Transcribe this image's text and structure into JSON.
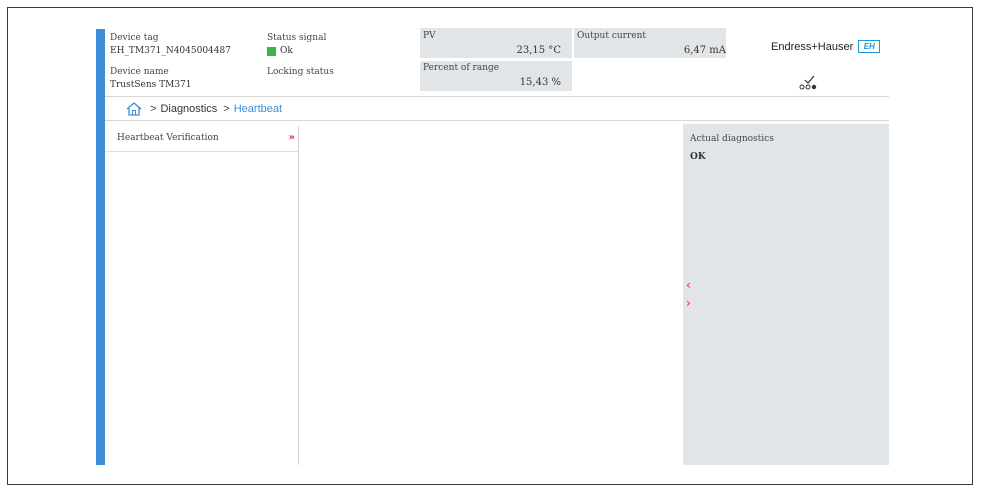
{
  "header": {
    "device_tag_label": "Device tag",
    "device_tag_value": "EH_TM371_N4045004487",
    "status_signal_label": "Status signal",
    "status_signal_value": "Ok",
    "status_signal_color": "#3cb44b",
    "device_name_label": "Device name",
    "device_name_value": "TrustSens TM371",
    "locking_status_label": "Locking status",
    "pv_label": "PV",
    "pv_value": "23,15 °C",
    "output_current_label": "Output current",
    "output_current_value": "6,47 mA",
    "percent_range_label": "Percent of range",
    "percent_range_value": "15,43 %",
    "logo_text": "Endress+Hauser",
    "logo_mark": "EH"
  },
  "breadcrumb": {
    "items": [
      "Diagnostics",
      "Heartbeat"
    ],
    "separator": ">"
  },
  "nav": {
    "items": [
      {
        "label": "Heartbeat Verification",
        "arrow": "»"
      }
    ]
  },
  "diagnostics_panel": {
    "title": "Actual diagnostics",
    "value": "OK",
    "collapse_glyph": "‹",
    "expand_glyph": "›"
  },
  "colors": {
    "accent_blue": "#3d8ed8",
    "arrow_magenta": "#d42a63",
    "panel_gray": "#e2e5e7"
  },
  "icons": {
    "home": "home-icon",
    "connection": "connection-status-icon"
  }
}
